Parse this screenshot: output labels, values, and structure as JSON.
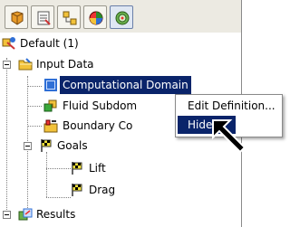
{
  "toolbar": {
    "buttons": [
      {
        "name": "feature-manager-icon"
      },
      {
        "name": "property-manager-icon"
      },
      {
        "name": "configuration-manager-icon"
      },
      {
        "name": "appearance-icon"
      },
      {
        "name": "analysis-tree-icon",
        "active": true
      }
    ]
  },
  "tree": {
    "root": {
      "label": "Default (1)"
    },
    "input_data": {
      "label": "Input Data"
    },
    "computational_domain": {
      "label": "Computational Domain"
    },
    "fluid_subdomains": {
      "label": "Fluid Subdom"
    },
    "boundary_conditions": {
      "label": "Boundary Co"
    },
    "goals": {
      "label": "Goals"
    },
    "lift": {
      "label": "Lift"
    },
    "drag": {
      "label": "Drag"
    },
    "results": {
      "label": "Results"
    }
  },
  "context_menu": {
    "items": [
      {
        "label": "Edit Definition..."
      },
      {
        "label": "Hide",
        "highlighted": true
      }
    ]
  },
  "colors": {
    "selection": "#0a246a",
    "toolbar_bg": "#eceae2",
    "folder": "#f2c23a",
    "domain_blue": "#2f6fd6"
  }
}
